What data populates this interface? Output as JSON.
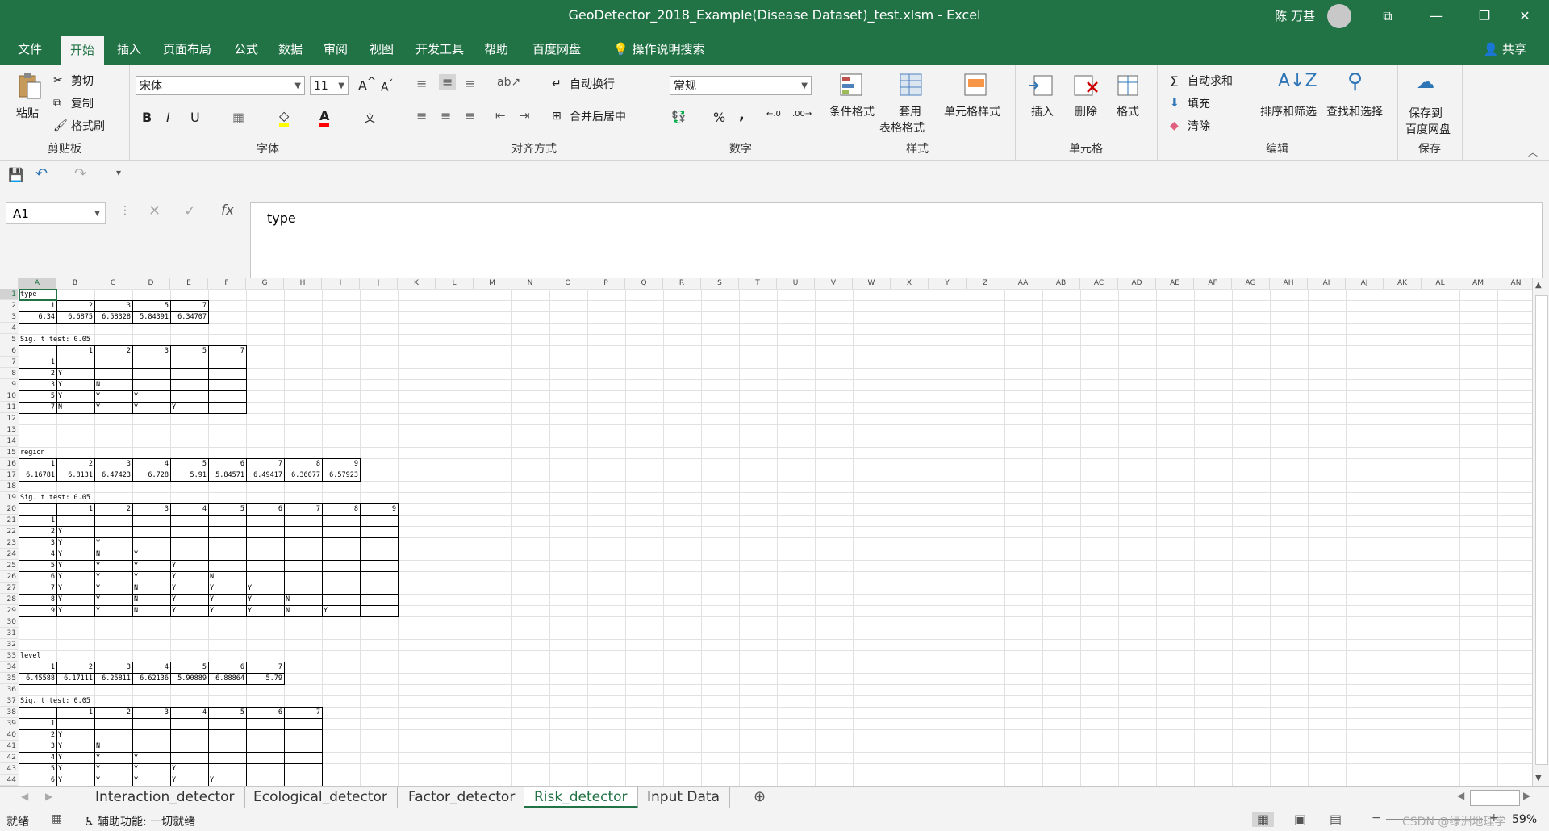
{
  "window": {
    "title": "GeoDetector_2018_Example(Disease Dataset)_test.xlsm  -  Excel",
    "user": "陈 万基",
    "controls": [
      "⧉",
      "—",
      "❐",
      "✕"
    ]
  },
  "menu": {
    "tabs": [
      "文件",
      "开始",
      "插入",
      "页面布局",
      "公式",
      "数据",
      "审阅",
      "视图",
      "开发工具",
      "帮助",
      "百度网盘"
    ],
    "active": "开始",
    "tell_me": "操作说明搜索",
    "share": "共享"
  },
  "ribbon": {
    "clipboard": {
      "paste": "粘贴",
      "cut": "剪切",
      "copy": "复制",
      "format_painter": "格式刷",
      "label": "剪贴板"
    },
    "font": {
      "name": "宋体",
      "size": "11",
      "label": "字体",
      "bold": "B",
      "italic": "I",
      "underline": "U"
    },
    "alignment": {
      "wrap": "自动换行",
      "merge": "合并后居中",
      "label": "对齐方式"
    },
    "number": {
      "format": "常规",
      "label": "数字",
      "percent": "%",
      "comma": ","
    },
    "styles": {
      "conditional": "条件格式",
      "table1": "套用",
      "table2": "表格格式",
      "cell_styles": "单元格样式",
      "label": "样式"
    },
    "cells": {
      "insert": "插入",
      "delete": "删除",
      "format": "格式",
      "label": "单元格"
    },
    "editing": {
      "autosum": "自动求和",
      "fill": "填充",
      "clear": "清除",
      "sort": "排序和筛选",
      "find": "查找和选择",
      "label": "编辑"
    },
    "save": {
      "line1": "保存到",
      "line2": "百度网盘",
      "label": "保存"
    }
  },
  "formula_bar": {
    "name_box": "A1",
    "content": "type",
    "fx": "fx"
  },
  "columns": [
    "A",
    "B",
    "C",
    "D",
    "E",
    "F",
    "G",
    "H",
    "I",
    "J",
    "K",
    "L",
    "M",
    "N",
    "O",
    "P",
    "Q",
    "R",
    "S",
    "T",
    "U",
    "V",
    "W",
    "X",
    "Y",
    "Z",
    "AA",
    "AB",
    "AC",
    "AD",
    "AE",
    "AF",
    "AG",
    "AH",
    "AI",
    "AJ",
    "AK",
    "AL",
    "AM",
    "AN"
  ],
  "rows": [
    "1",
    "2",
    "3",
    "4",
    "5",
    "6",
    "7",
    "8",
    "9",
    "10",
    "11",
    "12",
    "13",
    "14",
    "15",
    "16",
    "17",
    "18",
    "19",
    "20",
    "21",
    "22",
    "23",
    "24",
    "25",
    "26",
    "27",
    "28",
    "29",
    "30",
    "31",
    "32",
    "33",
    "34",
    "35",
    "36",
    "37",
    "38",
    "39",
    "40",
    "41",
    "42",
    "43",
    "44"
  ],
  "cells": [
    {
      "r": 1,
      "c": 0,
      "v": "type"
    },
    {
      "r": 2,
      "c": 0,
      "v": "1",
      "n": 1
    },
    {
      "r": 2,
      "c": 1,
      "v": "2",
      "n": 1
    },
    {
      "r": 2,
      "c": 2,
      "v": "3",
      "n": 1
    },
    {
      "r": 2,
      "c": 3,
      "v": "5",
      "n": 1
    },
    {
      "r": 2,
      "c": 4,
      "v": "7",
      "n": 1
    },
    {
      "r": 3,
      "c": 0,
      "v": "6.34",
      "n": 1
    },
    {
      "r": 3,
      "c": 1,
      "v": "6.6875",
      "n": 1
    },
    {
      "r": 3,
      "c": 2,
      "v": "6.58328",
      "n": 1
    },
    {
      "r": 3,
      "c": 3,
      "v": "5.84391",
      "n": 1
    },
    {
      "r": 3,
      "c": 4,
      "v": "6.34707",
      "n": 1
    },
    {
      "r": 5,
      "c": 0,
      "v": "Sig. t test: 0.05"
    },
    {
      "r": 6,
      "c": 1,
      "v": "1",
      "n": 1
    },
    {
      "r": 6,
      "c": 2,
      "v": "2",
      "n": 1
    },
    {
      "r": 6,
      "c": 3,
      "v": "3",
      "n": 1
    },
    {
      "r": 6,
      "c": 4,
      "v": "5",
      "n": 1
    },
    {
      "r": 6,
      "c": 5,
      "v": "7",
      "n": 1
    },
    {
      "r": 7,
      "c": 0,
      "v": "1",
      "n": 1
    },
    {
      "r": 8,
      "c": 0,
      "v": "2",
      "n": 1
    },
    {
      "r": 8,
      "c": 1,
      "v": "Y"
    },
    {
      "r": 9,
      "c": 0,
      "v": "3",
      "n": 1
    },
    {
      "r": 9,
      "c": 1,
      "v": "Y"
    },
    {
      "r": 9,
      "c": 2,
      "v": "N"
    },
    {
      "r": 10,
      "c": 0,
      "v": "5",
      "n": 1
    },
    {
      "r": 10,
      "c": 1,
      "v": "Y"
    },
    {
      "r": 10,
      "c": 2,
      "v": "Y"
    },
    {
      "r": 10,
      "c": 3,
      "v": "Y"
    },
    {
      "r": 11,
      "c": 0,
      "v": "7",
      "n": 1
    },
    {
      "r": 11,
      "c": 1,
      "v": "N"
    },
    {
      "r": 11,
      "c": 2,
      "v": "Y"
    },
    {
      "r": 11,
      "c": 3,
      "v": "Y"
    },
    {
      "r": 11,
      "c": 4,
      "v": "Y"
    },
    {
      "r": 15,
      "c": 0,
      "v": "region"
    },
    {
      "r": 16,
      "c": 0,
      "v": "1",
      "n": 1
    },
    {
      "r": 16,
      "c": 1,
      "v": "2",
      "n": 1
    },
    {
      "r": 16,
      "c": 2,
      "v": "3",
      "n": 1
    },
    {
      "r": 16,
      "c": 3,
      "v": "4",
      "n": 1
    },
    {
      "r": 16,
      "c": 4,
      "v": "5",
      "n": 1
    },
    {
      "r": 16,
      "c": 5,
      "v": "6",
      "n": 1
    },
    {
      "r": 16,
      "c": 6,
      "v": "7",
      "n": 1
    },
    {
      "r": 16,
      "c": 7,
      "v": "8",
      "n": 1
    },
    {
      "r": 16,
      "c": 8,
      "v": "9",
      "n": 1
    },
    {
      "r": 17,
      "c": 0,
      "v": "6.16781",
      "n": 1
    },
    {
      "r": 17,
      "c": 1,
      "v": "6.8131",
      "n": 1
    },
    {
      "r": 17,
      "c": 2,
      "v": "6.47423",
      "n": 1
    },
    {
      "r": 17,
      "c": 3,
      "v": "6.728",
      "n": 1
    },
    {
      "r": 17,
      "c": 4,
      "v": "5.91",
      "n": 1
    },
    {
      "r": 17,
      "c": 5,
      "v": "5.84571",
      "n": 1
    },
    {
      "r": 17,
      "c": 6,
      "v": "6.49417",
      "n": 1
    },
    {
      "r": 17,
      "c": 7,
      "v": "6.36077",
      "n": 1
    },
    {
      "r": 17,
      "c": 8,
      "v": "6.57923",
      "n": 1
    },
    {
      "r": 19,
      "c": 0,
      "v": "Sig. t test: 0.05"
    },
    {
      "r": 20,
      "c": 1,
      "v": "1",
      "n": 1
    },
    {
      "r": 20,
      "c": 2,
      "v": "2",
      "n": 1
    },
    {
      "r": 20,
      "c": 3,
      "v": "3",
      "n": 1
    },
    {
      "r": 20,
      "c": 4,
      "v": "4",
      "n": 1
    },
    {
      "r": 20,
      "c": 5,
      "v": "5",
      "n": 1
    },
    {
      "r": 20,
      "c": 6,
      "v": "6",
      "n": 1
    },
    {
      "r": 20,
      "c": 7,
      "v": "7",
      "n": 1
    },
    {
      "r": 20,
      "c": 8,
      "v": "8",
      "n": 1
    },
    {
      "r": 20,
      "c": 9,
      "v": "9",
      "n": 1
    },
    {
      "r": 21,
      "c": 0,
      "v": "1",
      "n": 1
    },
    {
      "r": 22,
      "c": 0,
      "v": "2",
      "n": 1
    },
    {
      "r": 22,
      "c": 1,
      "v": "Y"
    },
    {
      "r": 23,
      "c": 0,
      "v": "3",
      "n": 1
    },
    {
      "r": 23,
      "c": 1,
      "v": "Y"
    },
    {
      "r": 23,
      "c": 2,
      "v": "Y"
    },
    {
      "r": 24,
      "c": 0,
      "v": "4",
      "n": 1
    },
    {
      "r": 24,
      "c": 1,
      "v": "Y"
    },
    {
      "r": 24,
      "c": 2,
      "v": "N"
    },
    {
      "r": 24,
      "c": 3,
      "v": "Y"
    },
    {
      "r": 25,
      "c": 0,
      "v": "5",
      "n": 1
    },
    {
      "r": 25,
      "c": 1,
      "v": "Y"
    },
    {
      "r": 25,
      "c": 2,
      "v": "Y"
    },
    {
      "r": 25,
      "c": 3,
      "v": "Y"
    },
    {
      "r": 25,
      "c": 4,
      "v": "Y"
    },
    {
      "r": 26,
      "c": 0,
      "v": "6",
      "n": 1
    },
    {
      "r": 26,
      "c": 1,
      "v": "Y"
    },
    {
      "r": 26,
      "c": 2,
      "v": "Y"
    },
    {
      "r": 26,
      "c": 3,
      "v": "Y"
    },
    {
      "r": 26,
      "c": 4,
      "v": "Y"
    },
    {
      "r": 26,
      "c": 5,
      "v": "N"
    },
    {
      "r": 27,
      "c": 0,
      "v": "7",
      "n": 1
    },
    {
      "r": 27,
      "c": 1,
      "v": "Y"
    },
    {
      "r": 27,
      "c": 2,
      "v": "Y"
    },
    {
      "r": 27,
      "c": 3,
      "v": "N"
    },
    {
      "r": 27,
      "c": 4,
      "v": "Y"
    },
    {
      "r": 27,
      "c": 5,
      "v": "Y"
    },
    {
      "r": 27,
      "c": 6,
      "v": "Y"
    },
    {
      "r": 28,
      "c": 0,
      "v": "8",
      "n": 1
    },
    {
      "r": 28,
      "c": 1,
      "v": "Y"
    },
    {
      "r": 28,
      "c": 2,
      "v": "Y"
    },
    {
      "r": 28,
      "c": 3,
      "v": "N"
    },
    {
      "r": 28,
      "c": 4,
      "v": "Y"
    },
    {
      "r": 28,
      "c": 5,
      "v": "Y"
    },
    {
      "r": 28,
      "c": 6,
      "v": "Y"
    },
    {
      "r": 28,
      "c": 7,
      "v": "N"
    },
    {
      "r": 29,
      "c": 0,
      "v": "9",
      "n": 1
    },
    {
      "r": 29,
      "c": 1,
      "v": "Y"
    },
    {
      "r": 29,
      "c": 2,
      "v": "Y"
    },
    {
      "r": 29,
      "c": 3,
      "v": "N"
    },
    {
      "r": 29,
      "c": 4,
      "v": "Y"
    },
    {
      "r": 29,
      "c": 5,
      "v": "Y"
    },
    {
      "r": 29,
      "c": 6,
      "v": "Y"
    },
    {
      "r": 29,
      "c": 7,
      "v": "N"
    },
    {
      "r": 29,
      "c": 8,
      "v": "Y"
    },
    {
      "r": 33,
      "c": 0,
      "v": "level"
    },
    {
      "r": 34,
      "c": 0,
      "v": "1",
      "n": 1
    },
    {
      "r": 34,
      "c": 1,
      "v": "2",
      "n": 1
    },
    {
      "r": 34,
      "c": 2,
      "v": "3",
      "n": 1
    },
    {
      "r": 34,
      "c": 3,
      "v": "4",
      "n": 1
    },
    {
      "r": 34,
      "c": 4,
      "v": "5",
      "n": 1
    },
    {
      "r": 34,
      "c": 5,
      "v": "6",
      "n": 1
    },
    {
      "r": 34,
      "c": 6,
      "v": "7",
      "n": 1
    },
    {
      "r": 35,
      "c": 0,
      "v": "6.45588",
      "n": 1
    },
    {
      "r": 35,
      "c": 1,
      "v": "6.17111",
      "n": 1
    },
    {
      "r": 35,
      "c": 2,
      "v": "6.25811",
      "n": 1
    },
    {
      "r": 35,
      "c": 3,
      "v": "6.62136",
      "n": 1
    },
    {
      "r": 35,
      "c": 4,
      "v": "5.90889",
      "n": 1
    },
    {
      "r": 35,
      "c": 5,
      "v": "6.88864",
      "n": 1
    },
    {
      "r": 35,
      "c": 6,
      "v": "5.79",
      "n": 1
    },
    {
      "r": 37,
      "c": 0,
      "v": "Sig. t test: 0.05"
    },
    {
      "r": 38,
      "c": 1,
      "v": "1",
      "n": 1
    },
    {
      "r": 38,
      "c": 2,
      "v": "2",
      "n": 1
    },
    {
      "r": 38,
      "c": 3,
      "v": "3",
      "n": 1
    },
    {
      "r": 38,
      "c": 4,
      "v": "4",
      "n": 1
    },
    {
      "r": 38,
      "c": 5,
      "v": "5",
      "n": 1
    },
    {
      "r": 38,
      "c": 6,
      "v": "6",
      "n": 1
    },
    {
      "r": 38,
      "c": 7,
      "v": "7",
      "n": 1
    },
    {
      "r": 39,
      "c": 0,
      "v": "1",
      "n": 1
    },
    {
      "r": 40,
      "c": 0,
      "v": "2",
      "n": 1
    },
    {
      "r": 40,
      "c": 1,
      "v": "Y"
    },
    {
      "r": 41,
      "c": 0,
      "v": "3",
      "n": 1
    },
    {
      "r": 41,
      "c": 1,
      "v": "Y"
    },
    {
      "r": 41,
      "c": 2,
      "v": "N"
    },
    {
      "r": 42,
      "c": 0,
      "v": "4",
      "n": 1
    },
    {
      "r": 42,
      "c": 1,
      "v": "Y"
    },
    {
      "r": 42,
      "c": 2,
      "v": "Y"
    },
    {
      "r": 42,
      "c": 3,
      "v": "Y"
    },
    {
      "r": 43,
      "c": 0,
      "v": "5",
      "n": 1
    },
    {
      "r": 43,
      "c": 1,
      "v": "Y"
    },
    {
      "r": 43,
      "c": 2,
      "v": "Y"
    },
    {
      "r": 43,
      "c": 3,
      "v": "Y"
    },
    {
      "r": 43,
      "c": 4,
      "v": "Y"
    },
    {
      "r": 44,
      "c": 0,
      "v": "6",
      "n": 1
    },
    {
      "r": 44,
      "c": 1,
      "v": "Y"
    },
    {
      "r": 44,
      "c": 2,
      "v": "Y"
    },
    {
      "r": 44,
      "c": 3,
      "v": "Y"
    },
    {
      "r": 44,
      "c": 4,
      "v": "Y"
    },
    {
      "r": 44,
      "c": 5,
      "v": "Y"
    }
  ],
  "tables": [
    {
      "r1": 2,
      "c1": 0,
      "r2": 3,
      "c2": 4
    },
    {
      "r1": 6,
      "c1": 0,
      "r2": 11,
      "c2": 5
    },
    {
      "r1": 16,
      "c1": 0,
      "r2": 17,
      "c2": 8
    },
    {
      "r1": 20,
      "c1": 0,
      "r2": 29,
      "c2": 9
    },
    {
      "r1": 34,
      "c1": 0,
      "r2": 35,
      "c2": 6
    },
    {
      "r1": 38,
      "c1": 0,
      "r2": 44,
      "c2": 7
    }
  ],
  "sheet_tabs": [
    "Interaction_detector",
    "Ecological_detector",
    "Factor_detector",
    "Risk_detector",
    "Input Data"
  ],
  "active_sheet": "Risk_detector",
  "status": {
    "ready": "就绪",
    "accessibility": "辅助功能: 一切就绪",
    "zoom": "59%",
    "watermark": "CSDN @绿洲地理学"
  },
  "colors": {
    "excel_green": "#217346"
  }
}
